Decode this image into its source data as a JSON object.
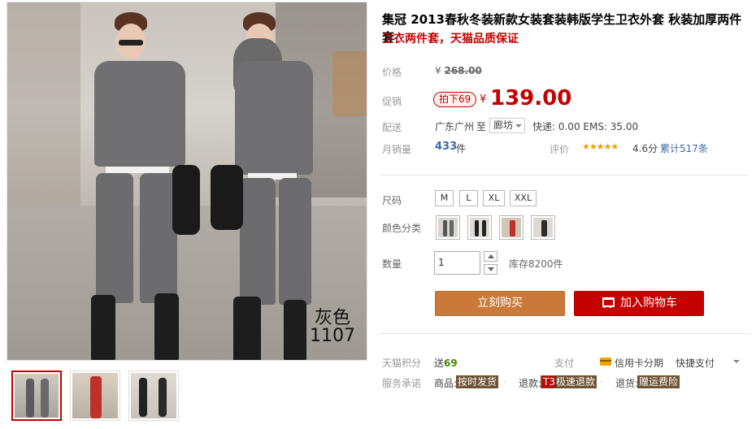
{
  "product": {
    "title": "集冠 2013春秋冬装新款女装套装韩版学生卫衣外套 秋装加厚两件套",
    "subtitle": "卫衣两件套，天猫品质保证"
  },
  "gallery": {
    "main_photo_tag": "灰色\n1107",
    "main_photo_tag_line1": "灰色",
    "main_photo_tag_line2": "1107",
    "thumbnail_count": 3
  },
  "price": {
    "label_price": "价格",
    "original_symbol": "¥",
    "original": "268.00",
    "label_promo": "促销",
    "promo_tag": "拍下69",
    "currency": "¥",
    "current": "139.00"
  },
  "shipping": {
    "label": "配送",
    "origin": "广东广州",
    "to": "至",
    "destination": "廊坊",
    "fee": "快递: 0.00 EMS: 35.00"
  },
  "sales": {
    "label": "月销量",
    "count": "433",
    "unit": "件",
    "rating_label": "评价",
    "stars": "★★★★★",
    "score": "4.6分",
    "review_count": "累计517条"
  },
  "options": {
    "size_label": "尺码",
    "sizes": [
      "M",
      "L",
      "XL",
      "XXL"
    ],
    "color_label": "颜色分类",
    "color_swatch_count": 4,
    "qty_label": "数量",
    "qty_value": "1",
    "stock": "库存8200件"
  },
  "actions": {
    "buy_now": "立刻购买",
    "add_cart": "加入购物车"
  },
  "services": {
    "points_label": "天猫积分",
    "points_prefix": "送",
    "points_value": "69",
    "pay_label": "支付",
    "pay_credit": "信用卡分期",
    "pay_quick": "快捷支付",
    "promise_label": "服务承诺",
    "goods_label": "商品:",
    "goods_tag": "按时发货",
    "refund_label": "退款:",
    "refund_t3": "T3",
    "refund_tag": "极速退款",
    "return_label": "退货:",
    "return_tag": "赠运费险"
  },
  "colors": {
    "accent_red": "#c40000",
    "buy_orange": "#c97a3a",
    "link_blue": "#3a69a7",
    "star_gold": "#e8a300"
  }
}
